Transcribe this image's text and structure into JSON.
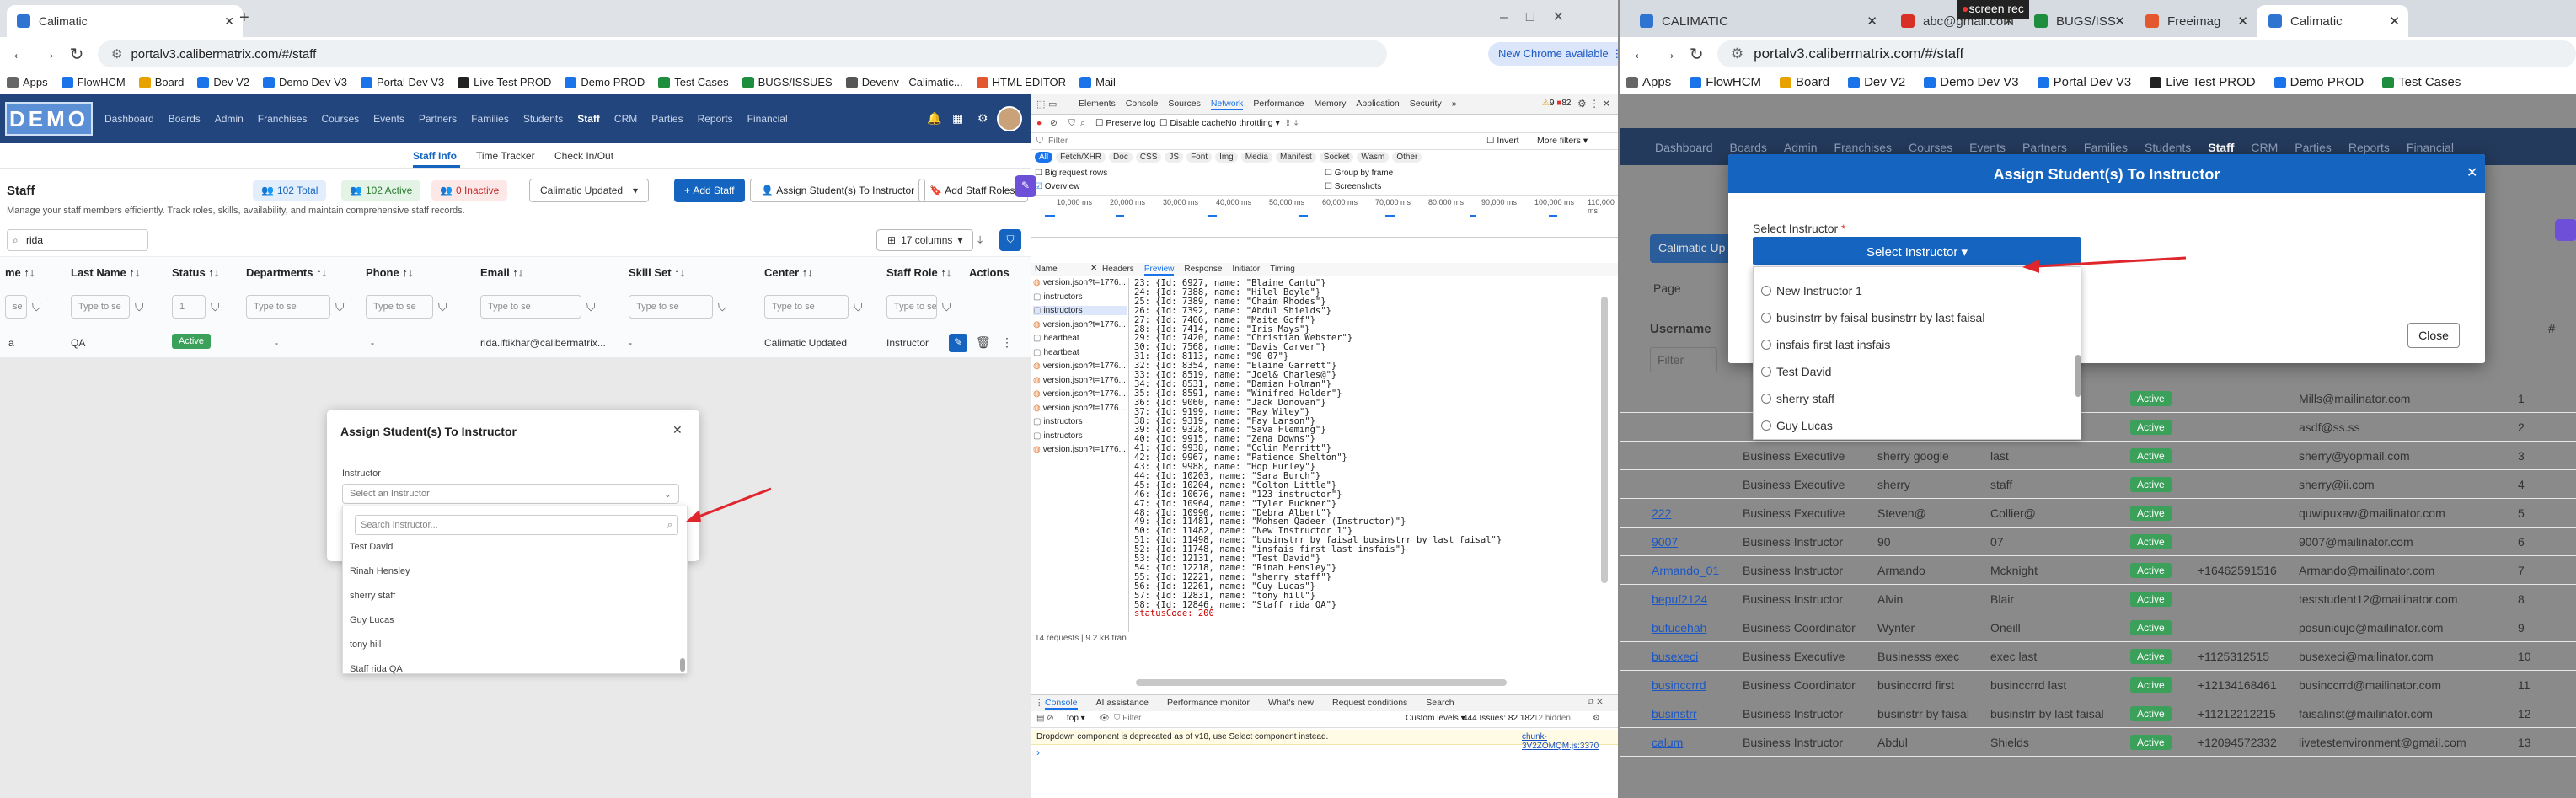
{
  "left": {
    "tab_title": "Calimatic",
    "url": "portalv3.calibermatrix.com/#/staff",
    "new_chrome": "New Chrome available",
    "bookmarks": [
      "Apps",
      "FlowHCM",
      "Board",
      "Dev V2",
      "Demo Dev V3",
      "Portal Dev V3",
      "Live Test PROD",
      "Demo PROD",
      "Test Cases",
      "BUGS/ISSUES",
      "Devenv - Calimatic...",
      "HTML EDITOR",
      "Mail"
    ],
    "logo": "DEMO",
    "nav": [
      "Dashboard",
      "Boards",
      "Admin",
      "Franchises",
      "Courses",
      "Events",
      "Partners",
      "Families",
      "Students",
      "Staff",
      "CRM",
      "Parties",
      "Reports",
      "Financial"
    ],
    "subtabs": [
      "Staff Info",
      "Time Tracker",
      "Check In/Out"
    ],
    "page_title": "Staff",
    "page_desc": "Manage your staff members efficiently. Track roles, skills, availability, and maintain comprehensive staff records.",
    "total": "102 Total",
    "active": "102 Active",
    "inactive": "0 Inactive",
    "dropdown": "Calimatic Updated",
    "add_staff": "Add Staff",
    "assign_btn": "Assign Student(s) To Instructor",
    "add_staff_roles": "Add Staff Roles",
    "search_value": "rida",
    "columns_btn": "17 columns",
    "headers": [
      "me ↑↓",
      "Last Name ↑↓",
      "Status ↑↓",
      "Departments ↑↓",
      "Phone ↑↓",
      "Email ↑↓",
      "Skill Set ↑↓",
      "Center ↑↓",
      "Staff Role ↑↓",
      "Actions"
    ],
    "filter_placeholder": "Type to se",
    "filter_small": "se",
    "filter_select": "1",
    "row": {
      "first": "a",
      "last": "QA",
      "status": "Active",
      "dept": "-",
      "phone": "-",
      "email": "rida.iftikhar@calibermatrix...",
      "skill": "-",
      "center": "Calimatic Updated",
      "role": "Instructor"
    },
    "modal": {
      "title": "Assign Student(s) To Instructor",
      "label": "Instructor",
      "select_placeholder": "Select an Instructor",
      "search_placeholder": "Search instructor...",
      "options": [
        "Test David",
        "Rinah Hensley",
        "sherry staff",
        "Guy Lucas",
        "tony hill",
        "Staff rida QA"
      ]
    },
    "devtools": {
      "tabs": [
        "Elements",
        "Console",
        "Sources",
        "Network",
        "Performance",
        "Memory",
        "Application",
        "Security",
        "»"
      ],
      "badges": {
        "warn": "9",
        "err": "82"
      },
      "throttle": "No throttling",
      "preserve_log": "Preserve log",
      "disable_cache": "Disable cache",
      "filter": "Filter",
      "invert": "Invert",
      "more_filters": "More filters",
      "types": [
        "All",
        "Fetch/XHR",
        "Doc",
        "CSS",
        "JS",
        "Font",
        "Img",
        "Media",
        "Manifest",
        "Socket",
        "Wasm",
        "Other"
      ],
      "big_rows": "Big request rows",
      "group_frame": "Group by frame",
      "overview": "Overview",
      "screenshots": "Screenshots",
      "timeline": [
        "10,000 ms",
        "20,000 ms",
        "30,000 ms",
        "40,000 ms",
        "50,000 ms",
        "60,000 ms",
        "70,000 ms",
        "80,000 ms",
        "90,000 ms",
        "100,000 ms",
        "110,000 ms"
      ],
      "name_header": "Name",
      "requests": [
        "version.json?t=1776...",
        "instructors",
        "instructors",
        "version.json?t=1776...",
        "heartbeat",
        "heartbeat",
        "version.json?t=1776...",
        "version.json?t=1776...",
        "version.json?t=1776...",
        "version.json?t=1776...",
        "instructors",
        "instructors",
        "version.json?t=1776..."
      ],
      "detail_tabs": [
        "Headers",
        "Preview",
        "Response",
        "Initiator",
        "Timing"
      ],
      "preview_lines": [
        "23: {Id: 6927, name: \"Blaine Cantu\"}",
        "24: {Id: 7388, name: \"Hilel Boyle\"}",
        "25: {Id: 7389, name: \"Chaim Rhodes\"}",
        "26: {Id: 7392, name: \"Abdul Shields\"}",
        "27: {Id: 7406, name: \"Maite Goff\"}",
        "28: {Id: 7414, name: \"Iris Mays\"}",
        "29: {Id: 7420, name: \"Christian Webster\"}",
        "30: {Id: 7568, name: \"Davis Carver\"}",
        "31: {Id: 8113, name: \"90 07\"}",
        "32: {Id: 8354, name: \"Elaine Garrett\"}",
        "33: {Id: 8519, name: \"Joel& Charles@\"}",
        "34: {Id: 8531, name: \"Damian Holman\"}",
        "35: {Id: 8591, name: \"Winifred Holder\"}",
        "36: {Id: 9060, name: \"Jack Donovan\"}",
        "37: {Id: 9199, name: \"Ray Wiley\"}",
        "38: {Id: 9319, name: \"Fay Larson\"}",
        "39: {Id: 9328, name: \"Sava Fleming\"}",
        "40: {Id: 9915, name: \"Zena Downs\"}",
        "41: {Id: 9938, name: \"Colin Merritt\"}",
        "42: {Id: 9967, name: \"Patience Shelton\"}",
        "43: {Id: 9988, name: \"Hop Hurley\"}",
        "44: {Id: 10203, name: \"Sara Burch\"}",
        "45: {Id: 10204, name: \"Colton Little\"}",
        "46: {Id: 10676, name: \"123 instructor\"}",
        "47: {Id: 10964, name: \"Tyler Buckner\"}",
        "48: {Id: 10990, name: \"Debra Albert\"}",
        "49: {Id: 11481, name: \"Mohsen Qadeer (Instructor)\"}",
        "50: {Id: 11482, name: \"New Instructor 1\"}",
        "51: {Id: 11498, name: \"businstrr by faisal businstrr by last faisal\"}",
        "52: {Id: 11748, name: \"insfais first last insfais\"}",
        "53: {Id: 12131, name: \"Test David\"}",
        "54: {Id: 12218, name: \"Rinah Hensley\"}",
        "55: {Id: 12221, name: \"sherry staff\"}",
        "56: {Id: 12261, name: \"Guy Lucas\"}",
        "57: {Id: 12831, name: \"tony hill\"}",
        "58: {Id: 12846, name: \"Staff rida QA\"}"
      ],
      "status_line": "statusCode: 200",
      "summary": "14 requests | 9.2 kB tran",
      "console_tabs": [
        "Console",
        "AI assistance",
        "Performance monitor",
        "What's new",
        "Request conditions",
        "Search"
      ],
      "context": "top",
      "console_filter": "Filter",
      "levels": "Custom levels",
      "issues": "444 Issues: 82 182",
      "hidden": "12 hidden",
      "console_msg": "Dropdown component is deprecated as of v18, use Select component instead.",
      "console_src": "chunk-3V2ZOMQM.js:3370"
    }
  },
  "right": {
    "tabs": [
      "CALIMATIC",
      "abc@gmail.com",
      "BUGS/ISS",
      "Freeimag",
      "Calimatic"
    ],
    "rec_label": "screen rec",
    "url": "portalv3.calibermatrix.com/#/staff",
    "bookmarks": [
      "Apps",
      "FlowHCM",
      "Board",
      "Dev V2",
      "Demo Dev V3",
      "Portal Dev V3",
      "Live Test PROD",
      "Demo PROD",
      "Test Cases"
    ],
    "nav": [
      "Dashboard",
      "Boards",
      "Admin",
      "Franchises",
      "Courses",
      "Events",
      "Partners",
      "Families",
      "Students",
      "Staff",
      "CRM",
      "Parties",
      "Reports",
      "Financial"
    ],
    "calimatic_btn": "Calimatic Up",
    "page_label": "Page",
    "col_username": "Username",
    "col_hash": "#",
    "filter_ph": "Filter",
    "modal": {
      "title": "Assign Student(s) To Instructor",
      "label": "Select Instructor",
      "required": "*",
      "button": "Select Instructor",
      "options": [
        "New Instructor 1",
        "businstrr by faisal businstrr by last faisal",
        "insfais first last insfais",
        "Test David",
        "sherry staff",
        "Guy Lucas"
      ],
      "close": "Close"
    },
    "rows": [
      {
        "user": "",
        "role": "Business Executive",
        "first": "sherry google",
        "last": "last",
        "phone": "",
        "email": "sherry@yopmail.com",
        "n": "3"
      },
      {
        "user": "",
        "role": "Business Executive",
        "first": "sherry",
        "last": "staff",
        "phone": "",
        "email": "sherry@ii.com",
        "n": "4"
      },
      {
        "user": "222",
        "role": "Business Executive",
        "first": "Steven@",
        "last": "Collier@",
        "phone": "",
        "email": "quwipuxaw@mailinator.com",
        "n": "5"
      },
      {
        "user": "9007",
        "role": "Business Instructor",
        "first": "90",
        "last": "07",
        "phone": "",
        "email": "9007@mailinator.com",
        "n": "6"
      },
      {
        "user": "Armando_01",
        "role": "Business Instructor",
        "first": "Armando",
        "last": "Mcknight",
        "phone": "+16462591516",
        "email": "Armando@mailinator.com",
        "n": "7"
      },
      {
        "user": "bepuf2124",
        "role": "Business Instructor",
        "first": "Alvin",
        "last": "Blair",
        "phone": "",
        "email": "teststudent12@mailinator.com",
        "n": "8"
      },
      {
        "user": "bufucehah",
        "role": "Business Coordinator",
        "first": "Wynter",
        "last": "Oneill",
        "phone": "",
        "email": "posunicujo@mailinator.com",
        "n": "9"
      },
      {
        "user": "busexeci",
        "role": "Business Executive",
        "first": "Businesss exec",
        "last": "exec last",
        "phone": "+1125312515",
        "email": "busexeci@mailinator.com",
        "n": "10"
      },
      {
        "user": "businccrrd",
        "role": "Business Coordinator",
        "first": "businccrrd first",
        "last": "businccrrd last",
        "phone": "+12134168461",
        "email": "businccrrd@mailinator.com",
        "n": "11"
      },
      {
        "user": "businstrr",
        "role": "Business Instructor",
        "first": "businstrr by faisal",
        "last": "businstrr by last faisal",
        "phone": "+11212212215",
        "email": "faisalinst@mailinator.com",
        "n": "12"
      },
      {
        "user": "calum",
        "role": "Business Instructor",
        "first": "Abdul",
        "last": "Shields",
        "phone": "+12094572332",
        "email": "livetestenvironment@gmail.com",
        "n": "13"
      }
    ],
    "top_emails": [
      {
        "email": "Mills@mailinator.com",
        "n": "1"
      },
      {
        "email": "asdf@ss.ss",
        "n": "2"
      }
    ],
    "status": "Active"
  },
  "colors": {
    "nav": "#23457d",
    "primary": "#1565c0",
    "active": "#3aa05a",
    "danger": "#e53935",
    "arrow": "#e0262d"
  }
}
